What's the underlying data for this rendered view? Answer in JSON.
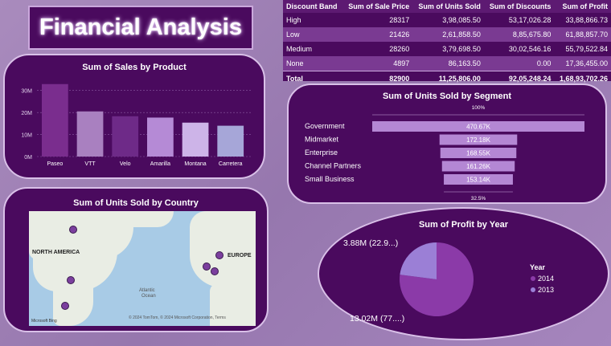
{
  "dashboard_title": "Financial Analysis",
  "table": {
    "headers": [
      "Discount Band",
      "Sum of Sale Price",
      "Sum of Units Sold",
      "Sum of Discounts",
      "Sum of Profit"
    ],
    "rows": [
      [
        "High",
        "28317",
        "3,98,085.50",
        "53,17,026.28",
        "33,88,866.73"
      ],
      [
        "Low",
        "21426",
        "2,61,858.50",
        "8,85,675.80",
        "61,88,857.70"
      ],
      [
        "Medium",
        "28260",
        "3,79,698.50",
        "30,02,546.16",
        "55,79,522.84"
      ],
      [
        "None",
        "4897",
        "86,163.50",
        "0.00",
        "17,36,455.00"
      ]
    ],
    "total": [
      "Total",
      "82900",
      "11,25,806.00",
      "92,05,248.24",
      "1,68,93,702.26"
    ]
  },
  "colors": {
    "panel": "#4a0a5e",
    "bar_segment": "#b487d4",
    "accent": "#8e44ad"
  },
  "chart_data": [
    {
      "type": "bar",
      "title": "Sum of Sales by Product",
      "categories": [
        "Paseo",
        "VTT",
        "Velo",
        "Amarilla",
        "Montana",
        "Carretera"
      ],
      "values": [
        32.9,
        20.5,
        18.3,
        17.7,
        15.4,
        14.0
      ],
      "unit": "M",
      "ylim": [
        0,
        35
      ],
      "yticks": [
        "0M",
        "10M",
        "20M",
        "30M"
      ],
      "colors": [
        "#7a2d8e",
        "#a980c0",
        "#6e2a88",
        "#b58ad6",
        "#cdb4e8",
        "#a6a6d8"
      ],
      "grid": true
    },
    {
      "type": "bar",
      "title": "Sum of Units Sold by Segment",
      "orientation": "horizontal-funnel",
      "categories": [
        "Government",
        "Midmarket",
        "Enterprise",
        "Channel Partners",
        "Small Business"
      ],
      "values": [
        470.67,
        172.18,
        168.55,
        161.26,
        153.14
      ],
      "data_labels": [
        "470.67K",
        "172.18K",
        "168.55K",
        "161.26K",
        "153.14K"
      ],
      "top_label": "100%",
      "bottom_label": "32.5%"
    },
    {
      "type": "pie",
      "title": "Sum of Profit by Year",
      "legend_title": "Year",
      "legend_position": "right",
      "slices": [
        {
          "label": "2014",
          "value": 13.02,
          "text": "13.02M (77....)",
          "color": "#8b3aa8"
        },
        {
          "label": "2013",
          "value": 3.88,
          "text": "3.88M (22.9...)",
          "color": "#9b7fd6"
        }
      ]
    }
  ],
  "map": {
    "title": "Sum of Units Sold by Country",
    "labels": {
      "north_america": "NORTH AMERICA",
      "europe": "EUROPE",
      "ocean_1": "Atlantic",
      "ocean_2": "Ocean"
    },
    "attribution": "© 2024 TomTom, © 2024 Microsoft Corporation, Terms",
    "logo": "Microsoft Bing"
  }
}
